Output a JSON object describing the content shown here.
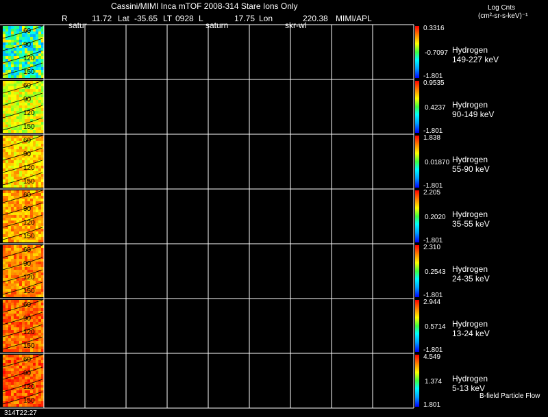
{
  "header": {
    "title": "Cassini/MIMI Inca mTOF  2008-314   Stare   Ions Only",
    "r_label": "R",
    "r_value": "11.72",
    "lat_label": "Lat",
    "lat_value": "-35.65",
    "lt_label": "LT",
    "lt_value": "0928",
    "l_label": "L",
    "l_value": "17.75",
    "lon_label": "Lon",
    "lon_value": "220.38",
    "source": "MIMI/APL",
    "overlay_1": "satur",
    "overlay_2": "saturn",
    "overlay_3": "skr-wl"
  },
  "colorbar_units": {
    "line1": "Log Cnts",
    "line2": "(cm²-sr-s-keV)⁻¹"
  },
  "panels": [
    {
      "species": "Hydrogen",
      "energy": "149-227 keV",
      "max": "0.3316",
      "mid": "-0.7097",
      "min": "-1.801",
      "ticks": [
        "60",
        "90",
        "120",
        "150"
      ]
    },
    {
      "species": "Hydrogen",
      "energy": "90-149 keV",
      "max": "0.9535",
      "mid": "0.4237",
      "min": "-1.801",
      "ticks": [
        "60",
        "90",
        "120",
        "150"
      ]
    },
    {
      "species": "Hydrogen",
      "energy": "55-90 keV",
      "max": "1.838",
      "mid": "0.01870",
      "min": "-1.801",
      "ticks": [
        "60",
        "90",
        "120",
        "150"
      ]
    },
    {
      "species": "Hydrogen",
      "energy": "35-55 keV",
      "max": "2.205",
      "mid": "0.2020",
      "min": "-1.801",
      "ticks": [
        "60",
        "90",
        "120",
        "150"
      ]
    },
    {
      "species": "Hydrogen",
      "energy": "24-35 keV",
      "max": "2.310",
      "mid": "0.2543",
      "min": "-1.801",
      "ticks": [
        "60",
        "90",
        "120",
        "150"
      ]
    },
    {
      "species": "Hydrogen",
      "energy": "13-24 keV",
      "max": "2.944",
      "mid": "0.5714",
      "min": "-1.801",
      "ticks": [
        "60",
        "90",
        "120",
        "150"
      ]
    },
    {
      "species": "Hydrogen",
      "energy": "5-13 keV",
      "max": "4.549",
      "mid": "1.374",
      "min": "1.801",
      "ticks": [
        "60",
        "90",
        "120",
        "150"
      ]
    }
  ],
  "footer": {
    "timestamp": "314T22:27",
    "bfield_label": "B-field Particle Flow"
  },
  "colors": {
    "background": "#000000",
    "grid": "#ffffff",
    "text": "#ffffff"
  },
  "chart_data": {
    "type": "heatmap",
    "title": "Cassini/MIMI Inca mTOF  2008-314   Stare   Ions Only",
    "series": [
      {
        "name": "149-227 keV",
        "range": [
          -1.801,
          0.3316
        ]
      },
      {
        "name": "90-149 keV",
        "range": [
          -1.801,
          0.9535
        ]
      },
      {
        "name": "55-90 keV",
        "range": [
          -1.801,
          1.838
        ]
      },
      {
        "name": "35-55 keV",
        "range": [
          -1.801,
          2.205
        ]
      },
      {
        "name": "24-35 keV",
        "range": [
          -1.801,
          2.31
        ]
      },
      {
        "name": "13-24 keV",
        "range": [
          -1.801,
          2.944
        ]
      },
      {
        "name": "5-13 keV",
        "range": [
          1.801,
          4.549
        ]
      }
    ],
    "thumbnail_levels": [
      0.45,
      0.65,
      0.72,
      0.78,
      0.82,
      0.86,
      0.88
    ],
    "grid_columns": 9,
    "grid_rows": 7,
    "grid": true
  }
}
